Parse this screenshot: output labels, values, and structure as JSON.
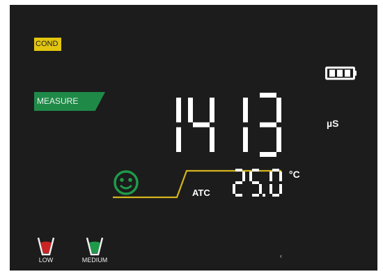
{
  "mode": {
    "label": "COND",
    "color": "#e2c60f"
  },
  "status": {
    "label": "MEASURE",
    "color": "#1f8a48"
  },
  "reading": {
    "value": "1413",
    "unit": "µS"
  },
  "temperature": {
    "value": "25.0",
    "unit": "°C",
    "compensation": "ATC"
  },
  "battery": {
    "bars_filled": 3,
    "bars_total": 3
  },
  "stability": {
    "icon": "smiley-icon",
    "color": "#1f9a4a"
  },
  "trend_line_color": "#d4b51e",
  "calibration_beakers": [
    {
      "label": "LOW",
      "fill_color": "#c92525",
      "icon": "beaker-low-icon"
    },
    {
      "label": "MEDIUM",
      "fill_color": "#1f9a4a",
      "icon": "beaker-medium-icon"
    }
  ],
  "misc_mark": "‹"
}
